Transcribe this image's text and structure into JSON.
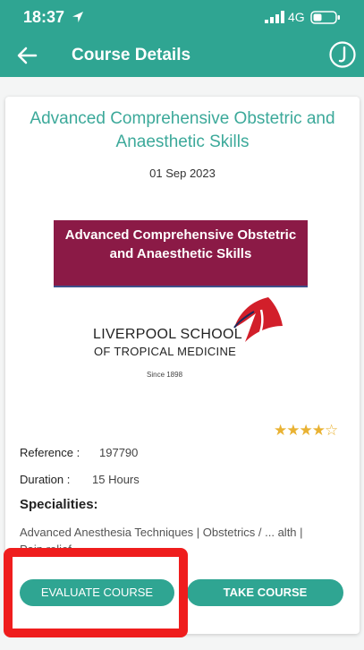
{
  "status_bar": {
    "time": "18:37",
    "network": "4G"
  },
  "header": {
    "title": "Course Details"
  },
  "course": {
    "title": "Advanced Comprehensive Obstetric and Anaesthetic Skills",
    "date": "01 Sep 2023",
    "banner_text": "Advanced Comprehensive Obstetric and Anaesthetic Skills",
    "provider_line1": "LIVERPOOL SCHOOL",
    "provider_line2": "OF TROPICAL MEDICINE",
    "provider_since": "Since 1898",
    "rating": 4,
    "rating_max": 5,
    "reference_label": "Reference :",
    "reference_value": "197790",
    "duration_label": "Duration :",
    "duration_value": "15 Hours",
    "specialities_label": "Specialities:",
    "specialities_value": "Advanced Anesthesia Techniques | Obstetrics / ... alth | Pain relief"
  },
  "actions": {
    "evaluate_label": "EVALUATE COURSE",
    "take_label": "TAKE COURSE"
  },
  "colors": {
    "accent": "#2fa592",
    "title_text": "#3ca99a",
    "banner": "#8b1a46",
    "highlight": "#ef1d1d",
    "star": "#e9b233"
  }
}
